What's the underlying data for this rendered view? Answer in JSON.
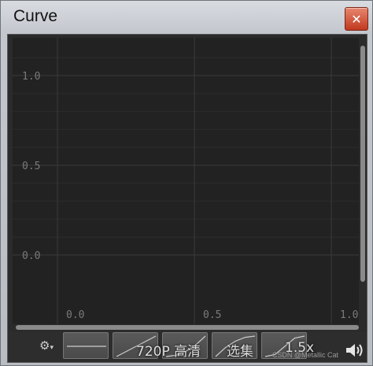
{
  "window": {
    "title": "Curve",
    "close_glyph": "✕"
  },
  "icons": {
    "close": "close-icon",
    "gear": "gear-icon",
    "speaker": "speaker-icon"
  },
  "colors": {
    "plot_bg": "#222222",
    "grid": "#3a3a3a",
    "label": "#7a7a7a",
    "curve": "#cccccc"
  },
  "chart_data": {
    "type": "line",
    "y_ticks": [
      "1.0",
      "0.5",
      "0.0"
    ],
    "x_ticks": [
      "0.0",
      "0.5",
      "1.0"
    ],
    "xlim": [
      0.0,
      1.0
    ],
    "ylim": [
      0.0,
      1.0
    ],
    "grid": true,
    "series": []
  },
  "presets": [
    {
      "id": "flat",
      "values": [
        [
          0,
          0.5
        ],
        [
          1,
          0.5
        ]
      ]
    },
    {
      "id": "linear",
      "values": [
        [
          0,
          0
        ],
        [
          1,
          1
        ]
      ]
    },
    {
      "id": "ease-in",
      "values": [
        [
          0,
          0
        ],
        [
          0.25,
          0.06
        ],
        [
          0.5,
          0.25
        ],
        [
          0.75,
          0.56
        ],
        [
          1,
          1
        ]
      ]
    },
    {
      "id": "ease-out",
      "values": [
        [
          0,
          0
        ],
        [
          0.25,
          0.44
        ],
        [
          0.5,
          0.75
        ],
        [
          0.75,
          0.94
        ],
        [
          1,
          1
        ]
      ]
    },
    {
      "id": "ease-in-out",
      "values": [
        [
          0,
          0
        ],
        [
          0.25,
          0.1
        ],
        [
          0.5,
          0.5
        ],
        [
          0.75,
          0.9
        ],
        [
          1,
          1
        ]
      ]
    }
  ],
  "overlay": {
    "quality": "720P 高清",
    "episodes": "选集",
    "speed": "1.5x",
    "watermark": "CSDN @Metallic Cat"
  }
}
